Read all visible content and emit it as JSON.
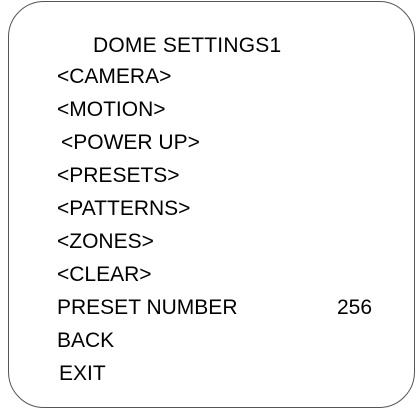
{
  "menu": {
    "title": "DOME SETTINGS1",
    "items": [
      "<CAMERA>",
      "<MOTION>",
      "<POWER UP>",
      "<PRESETS>",
      "<PATTERNS>",
      "<ZONES>",
      "<CLEAR>",
      "PRESET NUMBER",
      "BACK",
      "EXIT"
    ],
    "preset_number_value": "256"
  }
}
